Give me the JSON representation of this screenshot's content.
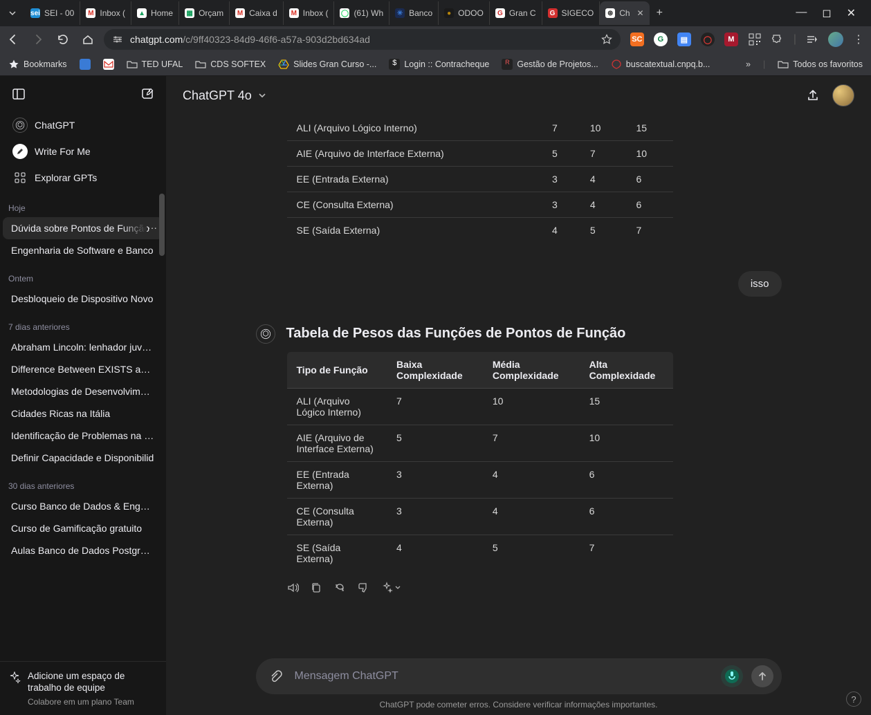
{
  "window": {
    "tabs": [
      {
        "label": "SEI - 00",
        "iconBg": "#1f8fd6",
        "iconFg": "#fff",
        "iconTxt": "sei"
      },
      {
        "label": "Inbox (",
        "iconBg": "#fff",
        "iconFg": "#d93025",
        "iconTxt": "M"
      },
      {
        "label": "Home",
        "iconBg": "#fff",
        "iconFg": "#1aa260",
        "iconTxt": "▲"
      },
      {
        "label": "Orçam",
        "iconBg": "#fff",
        "iconFg": "#0f9d58",
        "iconTxt": "▦"
      },
      {
        "label": "Caixa d",
        "iconBg": "#fff",
        "iconFg": "#d93025",
        "iconTxt": "M"
      },
      {
        "label": "Inbox (",
        "iconBg": "#fff",
        "iconFg": "#d93025",
        "iconTxt": "M"
      },
      {
        "label": "(61) Wh",
        "iconBg": "#fff",
        "iconFg": "#25d366",
        "iconTxt": "◯"
      },
      {
        "label": "Banco",
        "iconBg": "#1a2a50",
        "iconFg": "#3a7bd5",
        "iconTxt": "✳"
      },
      {
        "label": "ODOO",
        "iconBg": "#1a1a1a",
        "iconFg": "#b8860b",
        "iconTxt": "●"
      },
      {
        "label": "Gran C",
        "iconBg": "#fff",
        "iconFg": "#d32f2f",
        "iconTxt": "G"
      },
      {
        "label": "SIGECO",
        "iconBg": "#d32f2f",
        "iconFg": "#fff",
        "iconTxt": "G"
      },
      {
        "label": "Ch",
        "iconBg": "#fff",
        "iconFg": "#333",
        "iconTxt": "⊛",
        "active": true
      }
    ],
    "controls": {
      "min": "—",
      "max": "◻",
      "close": "✕"
    }
  },
  "toolbar": {
    "url_host": "chatgpt.com",
    "url_path": "/c/9ff40323-84d9-46f6-a57a-903d2bd634ad"
  },
  "bookmarks": {
    "items": [
      {
        "label": "Bookmarks",
        "iconType": "star"
      },
      {
        "label": "",
        "iconType": "cube",
        "iconBg": "#3a7bd5"
      },
      {
        "label": "",
        "iconType": "gmail"
      },
      {
        "label": "TED UFAL",
        "iconType": "folder"
      },
      {
        "label": "CDS SOFTEX",
        "iconType": "folder"
      },
      {
        "label": "Slides Gran Curso -...",
        "iconType": "gslides"
      },
      {
        "label": "Login :: Contracheque",
        "iconType": "dollar"
      },
      {
        "label": "Gestão de Projetos...",
        "iconType": "rk"
      },
      {
        "label": "buscatextual.cnpq.b...",
        "iconType": "red"
      }
    ],
    "overflow": "»",
    "allFav": "Todos os favoritos"
  },
  "sidebar": {
    "nav": {
      "chatgpt": "ChatGPT",
      "writeforme": "Write For Me",
      "explore": "Explorar GPTs"
    },
    "sections": [
      {
        "title": "Hoje",
        "items": [
          "Dúvida sobre Pontos de Função",
          "Engenharia de Software e Banco"
        ]
      },
      {
        "title": "Ontem",
        "items": [
          "Desbloqueio de Dispositivo Novo"
        ]
      },
      {
        "title": "7 dias anteriores",
        "items": [
          "Abraham Lincoln: lenhador juvenil",
          "Difference Between EXISTS and IN",
          "Metodologias de Desenvolvimento",
          "Cidades Ricas na Itália",
          "Identificação de Problemas na Ed",
          "Definir Capacidade e Disponibilid"
        ]
      },
      {
        "title": "30 dias anteriores",
        "items": [
          "Curso Banco de Dados & Engenh",
          "Curso de Gamificação gratuito",
          "Aulas Banco de Dados PostgreSQ"
        ]
      }
    ],
    "activeIndex": [
      0,
      0
    ],
    "upsell": {
      "line1": "Adicione um espaço de trabalho de equipe",
      "line2": "Colabore em um plano Team"
    }
  },
  "main": {
    "model": "ChatGPT 4o",
    "userMessage": "isso",
    "assistantTitle": "Tabela de Pesos das Funções de Pontos de Função",
    "tableHeaders": [
      "Tipo de Função",
      "Baixa Complexidade",
      "Média Complexidade",
      "Alta Complexidade"
    ],
    "tableRows": [
      [
        "ALI (Arquivo Lógico Interno)",
        "7",
        "10",
        "15"
      ],
      [
        "AIE (Arquivo de Interface Externa)",
        "5",
        "7",
        "10"
      ],
      [
        "EE (Entrada Externa)",
        "3",
        "4",
        "6"
      ],
      [
        "CE (Consulta Externa)",
        "3",
        "4",
        "6"
      ],
      [
        "SE (Saída Externa)",
        "4",
        "5",
        "7"
      ]
    ],
    "composerPlaceholder": "Mensagem ChatGPT",
    "disclaimer": "ChatGPT pode cometer erros. Considere verificar informações importantes.",
    "help": "?"
  },
  "chart_data": {
    "type": "table",
    "title": "Tabela de Pesos das Funções de Pontos de Função",
    "columns": [
      "Tipo de Função",
      "Baixa Complexidade",
      "Média Complexidade",
      "Alta Complexidade"
    ],
    "rows": [
      {
        "Tipo de Função": "ALI (Arquivo Lógico Interno)",
        "Baixa Complexidade": 7,
        "Média Complexidade": 10,
        "Alta Complexidade": 15
      },
      {
        "Tipo de Função": "AIE (Arquivo de Interface Externa)",
        "Baixa Complexidade": 5,
        "Média Complexidade": 7,
        "Alta Complexidade": 10
      },
      {
        "Tipo de Função": "EE (Entrada Externa)",
        "Baixa Complexidade": 3,
        "Média Complexidade": 4,
        "Alta Complexidade": 6
      },
      {
        "Tipo de Função": "CE (Consulta Externa)",
        "Baixa Complexidade": 3,
        "Média Complexidade": 4,
        "Alta Complexidade": 6
      },
      {
        "Tipo de Função": "SE (Saída Externa)",
        "Baixa Complexidade": 4,
        "Média Complexidade": 5,
        "Alta Complexidade": 7
      }
    ]
  }
}
